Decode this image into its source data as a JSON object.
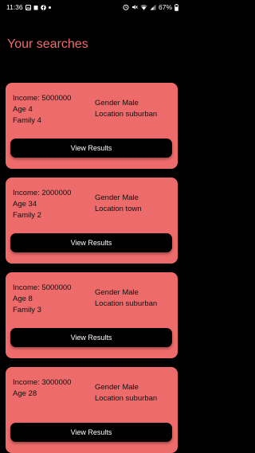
{
  "status_bar": {
    "time": "11:36",
    "battery": "67%"
  },
  "page_title": "Your searches",
  "searches": [
    {
      "income": "Income: 5000000",
      "age": "Age 4",
      "family": "Family 4",
      "gender": "Gender Male",
      "location": "Location suburban",
      "button_label": "View Results"
    },
    {
      "income": "Income: 2000000",
      "age": "Age 34",
      "family": "Family 2",
      "gender": "Gender Male",
      "location": "Location town",
      "button_label": "View Results"
    },
    {
      "income": "Income: 5000000",
      "age": "Age 8",
      "family": "Family 3",
      "gender": "Gender Male",
      "location": "Location suburban",
      "button_label": "View Results"
    },
    {
      "income": "Income: 3000000",
      "age": "Age 28",
      "family": "",
      "gender": "Gender Male",
      "location": "Location suburban",
      "button_label": "View Results"
    }
  ],
  "colors": {
    "background": "#000000",
    "accent": "#ef6c6c",
    "card": "#ee6b6b",
    "button": "#000000"
  }
}
